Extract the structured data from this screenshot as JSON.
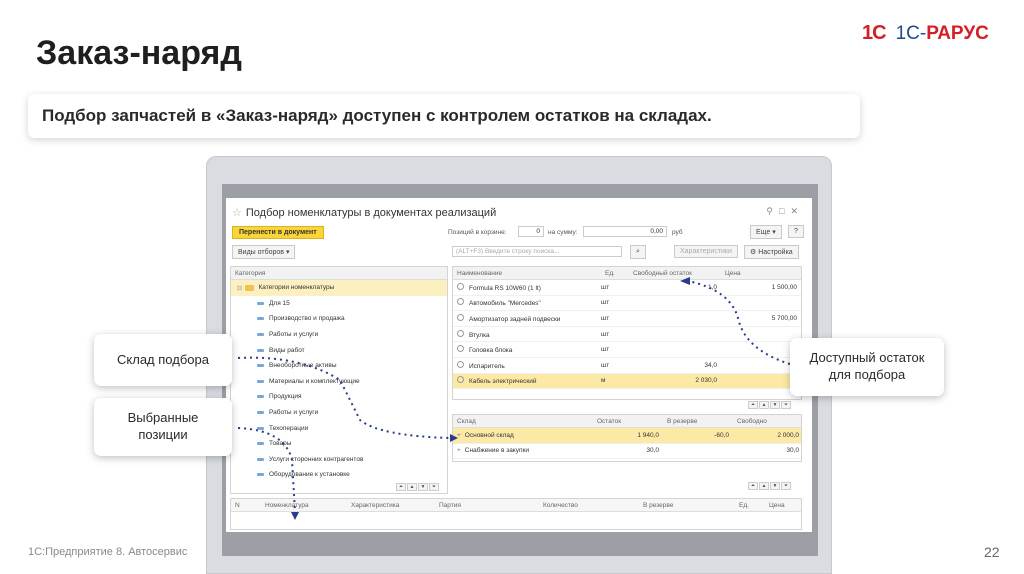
{
  "slide": {
    "title": "Заказ-наряд",
    "subtitle": "Подбор запчастей в «Заказ-наряд» доступен с контролем остатков на складах.",
    "footer": "1С:Предприятие 8. Автосервис",
    "page_number": "22"
  },
  "logo": {
    "left": "1С",
    "right_a": "1С-",
    "right_b": "РАРУС"
  },
  "window": {
    "title": "Подбор номенклатуры в документах реализаций",
    "transfer_button": "Перенести в документ",
    "filters_button": "Виды отборов",
    "cart_label": "Позиций в корзине:",
    "cart_value": "0",
    "sum_label": "на сумму:",
    "sum_value": "0,00",
    "currency": "руб",
    "more_button": "Еще",
    "help_button": "?",
    "search_placeholder": "(ALT+F3) Введите строку поиска...",
    "characteristics_button": "Характеристики",
    "settings_button": "Настройка"
  },
  "categories": {
    "header": "Категория",
    "root": "Категории номенклатуры",
    "items": [
      "Для 15",
      "Производство и продажа",
      "Работы и услуги",
      "Виды работ",
      "Внеоборотные активы",
      "Материалы и комплектующие",
      "Продукция",
      "Работы и услуги",
      "Техоперации",
      "Товары",
      "Услуги сторонних контрагентов",
      "Оборудование к установке"
    ]
  },
  "items_table": {
    "headers": [
      "Наименование",
      "Ед.",
      "Свободный остаток",
      "Цена"
    ],
    "rows": [
      {
        "name": "Formula RS 10W60 (1 lt)",
        "unit": "шт",
        "stock": "1,0",
        "price": "1 500,00",
        "selected": false
      },
      {
        "name": "Автомобиль \"Mercedes\"",
        "unit": "шт",
        "stock": "",
        "price": "",
        "selected": false
      },
      {
        "name": "Амортизатор задней подвески",
        "unit": "шт",
        "stock": "",
        "price": "5 700,00",
        "selected": false
      },
      {
        "name": "Втулка",
        "unit": "шт",
        "stock": "",
        "price": "",
        "selected": false
      },
      {
        "name": "Головка блока",
        "unit": "шт",
        "stock": "",
        "price": "",
        "selected": false
      },
      {
        "name": "Испаритель",
        "unit": "шт",
        "stock": "34,0",
        "price": "",
        "selected": false
      },
      {
        "name": "Кабель электрический",
        "unit": "м",
        "stock": "2 030,0",
        "price": "",
        "selected": true
      }
    ]
  },
  "warehouse_table": {
    "headers": [
      "Склад",
      "Остаток",
      "В резерве",
      "Свободно"
    ],
    "rows": [
      {
        "name": "Основной склад",
        "stock": "1 940,0",
        "reserve": "-60,0",
        "free": "2 000,0",
        "selected": true
      },
      {
        "name": "Снабжение в закупки",
        "stock": "30,0",
        "reserve": "",
        "free": "30,0",
        "selected": false
      }
    ]
  },
  "cart_table": {
    "headers": [
      "N",
      "Номенклатура",
      "Характеристика",
      "Партия",
      "Количество",
      "В резерве",
      "Ед.",
      "Цена"
    ]
  },
  "callouts": {
    "warehouse": "Склад подбора",
    "selected_a": "Выбранные",
    "selected_b": "позиции",
    "available_a": "Доступный остаток",
    "available_b": "для подбора"
  }
}
